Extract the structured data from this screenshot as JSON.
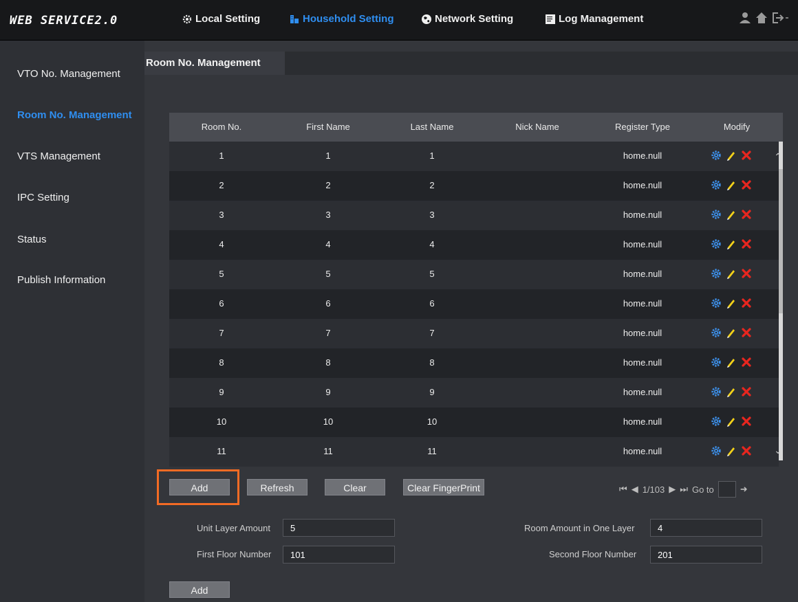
{
  "brand": "WEB SERVICE2.0",
  "nav": [
    {
      "label": "Local Setting",
      "icon": "gear-icon"
    },
    {
      "label": "Household Setting",
      "icon": "building-icon"
    },
    {
      "label": "Network Setting",
      "icon": "globe-icon"
    },
    {
      "label": "Log Management",
      "icon": "document-icon"
    }
  ],
  "top_right_icons": [
    "user-icon",
    "home-icon",
    "logout-icon"
  ],
  "sidebar": [
    {
      "label": "VTO No. Management"
    },
    {
      "label": "Room No. Management"
    },
    {
      "label": "VTS Management"
    },
    {
      "label": "IPC Setting"
    },
    {
      "label": "Status"
    },
    {
      "label": "Publish Information"
    }
  ],
  "tab": "Room No. Management",
  "table": {
    "headers": [
      "Room No.",
      "First Name",
      "Last Name",
      "Nick Name",
      "Register Type",
      "Modify"
    ],
    "rows": [
      {
        "room": "1",
        "first": "1",
        "last": "1",
        "nick": "",
        "type": "home.null"
      },
      {
        "room": "2",
        "first": "2",
        "last": "2",
        "nick": "",
        "type": "home.null"
      },
      {
        "room": "3",
        "first": "3",
        "last": "3",
        "nick": "",
        "type": "home.null"
      },
      {
        "room": "4",
        "first": "4",
        "last": "4",
        "nick": "",
        "type": "home.null"
      },
      {
        "room": "5",
        "first": "5",
        "last": "5",
        "nick": "",
        "type": "home.null"
      },
      {
        "room": "6",
        "first": "6",
        "last": "6",
        "nick": "",
        "type": "home.null"
      },
      {
        "room": "7",
        "first": "7",
        "last": "7",
        "nick": "",
        "type": "home.null"
      },
      {
        "room": "8",
        "first": "8",
        "last": "8",
        "nick": "",
        "type": "home.null"
      },
      {
        "room": "9",
        "first": "9",
        "last": "9",
        "nick": "",
        "type": "home.null"
      },
      {
        "room": "10",
        "first": "10",
        "last": "10",
        "nick": "",
        "type": "home.null"
      },
      {
        "room": "11",
        "first": "11",
        "last": "11",
        "nick": "",
        "type": "home.null"
      }
    ],
    "modify_icons": [
      "settings-gear-icon",
      "edit-pencil-icon",
      "delete-x-icon"
    ]
  },
  "buttons": {
    "add": "Add",
    "refresh": "Refresh",
    "clear": "Clear",
    "clear_fingerprint": "Clear FingerPrint",
    "add_bottom": "Add"
  },
  "pager": {
    "page": "1/103",
    "goto_label": "Go to",
    "goto_value": ""
  },
  "form": {
    "unit_layer_amount_label": "Unit Layer Amount",
    "unit_layer_amount": "5",
    "room_amount_label": "Room Amount in One Layer",
    "room_amount": "4",
    "first_floor_label": "First Floor Number",
    "first_floor": "101",
    "second_floor_label": "Second Floor Number",
    "second_floor": "201"
  },
  "colors": {
    "accent": "#2f8ef0",
    "highlight": "#f36b24",
    "delete": "#e8261f",
    "edit": "#f2d11a",
    "gear": "#3d8fe8"
  }
}
